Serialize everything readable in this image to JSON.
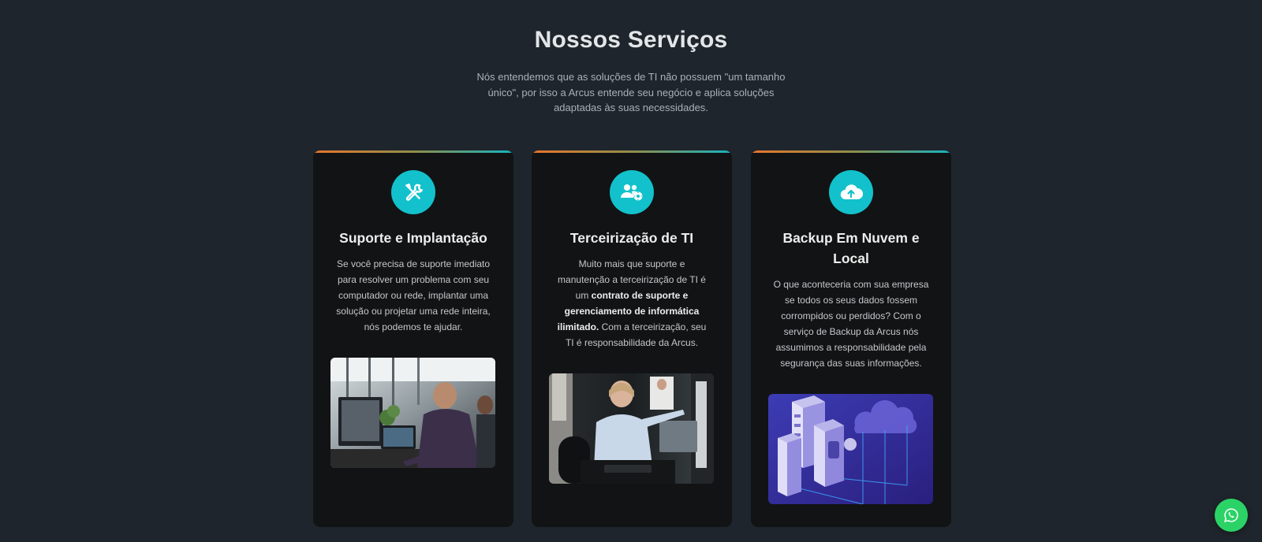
{
  "section": {
    "title": "Nossos Serviços",
    "intro": "Nós entendemos que as soluções de TI não possuem \"um tamanho único\", por isso a Arcus entende seu negócio e aplica soluções adaptadas às suas necessidades."
  },
  "cards": [
    {
      "icon": "tools-icon",
      "title": "Suporte e Implantação",
      "text": "Se você precisa de suporte imediato para resolver um problema com seu computador ou rede, implantar uma solução ou projetar uma rede inteira, nós podemos te ajudar.",
      "image": "person-at-computer-photo"
    },
    {
      "icon": "users-gear-icon",
      "title": "Terceirização de TI",
      "text_before": "Muito mais que suporte e manutenção a terceirização de TI é um ",
      "text_bold": "contrato de suporte e gerenciamento de informática ilimitado.",
      "text_after": " Com a terceirização, seu TI é responsabilidade da Arcus.",
      "image": "woman-pointing-at-screen-photo"
    },
    {
      "icon": "cloud-upload-icon",
      "title": "Backup Em Nuvem e Local",
      "text": "O que aconteceria com sua empresa se todos os seus dados fossem corrompidos ou perdidos? Com o serviço de Backup da Arcus nós assumimos a responsabilidade pela segurança das suas informações.",
      "image": "cloud-servers-illustration"
    }
  ],
  "whatsapp": {
    "icon": "whatsapp-icon"
  },
  "colors": {
    "background": "#1f252c",
    "card": "#121314",
    "icon_circle": "#12c1cb",
    "accent_start": "#e8762c",
    "accent_end": "#16b3be",
    "whatsapp": "#2bd366"
  }
}
